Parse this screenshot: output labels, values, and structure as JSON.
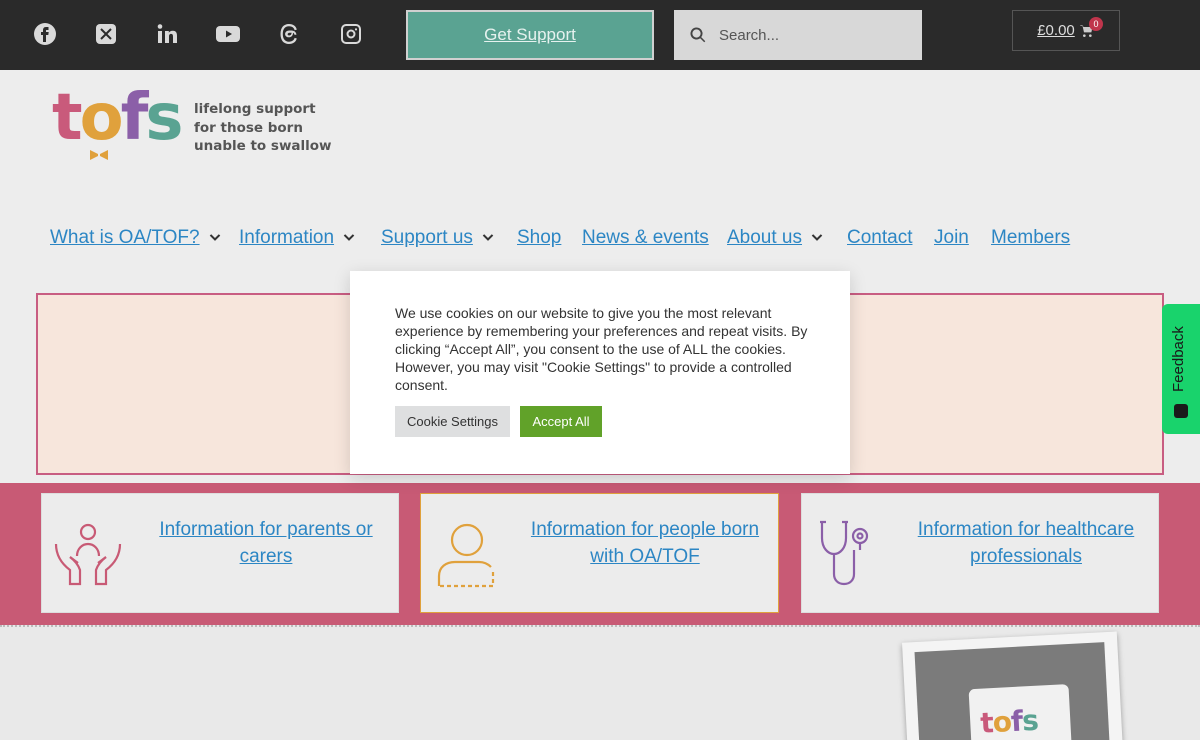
{
  "social": [
    "facebook-icon",
    "x-icon",
    "linkedin-icon",
    "youtube-icon",
    "threads-icon",
    "instagram-icon"
  ],
  "support_button": "Get Support",
  "search": {
    "placeholder": "Search..."
  },
  "cart": {
    "amount": "£0.00",
    "count": "0"
  },
  "logo": {
    "word_letters": [
      "t",
      "o",
      "f",
      "s"
    ],
    "tagline": [
      "lifelong support",
      "for those born",
      "unable to swallow"
    ]
  },
  "nav": [
    {
      "label": "What is OA/TOF?",
      "dropdown": true
    },
    {
      "label": "Information",
      "dropdown": true
    },
    {
      "label": "Support us",
      "dropdown": true
    },
    {
      "label": "Shop",
      "dropdown": false
    },
    {
      "label": "News & events",
      "dropdown": false
    },
    {
      "label": "About us",
      "dropdown": true
    },
    {
      "label": "Contact",
      "dropdown": false
    },
    {
      "label": "Join",
      "dropdown": false
    },
    {
      "label": "Members",
      "dropdown": false
    }
  ],
  "cookie": {
    "text": "We use cookies on our website to give you the most relevant experience by remembering your preferences and repeat visits. By clicking “Accept All”, you consent to the use of ALL the cookies. However, you may visit \"Cookie Settings\" to provide a controlled consent.",
    "settings_label": "Cookie Settings",
    "accept_label": "Accept All"
  },
  "cards": [
    {
      "label": "Information for parents or carers",
      "icon": "caring-hands-icon"
    },
    {
      "label": "Information for people born with OA/TOF",
      "icon": "person-icon"
    },
    {
      "label": "Information for healthcare professionals",
      "icon": "stethoscope-icon"
    }
  ],
  "feedback_label": "Feedback",
  "mug_text": "tofs",
  "colors": {
    "topbar": "#2a2a2a",
    "teal": "#5aa392",
    "pink": "#c85a75",
    "link": "#2c86c4",
    "accept": "#61a229",
    "feedback": "#19d36c"
  }
}
